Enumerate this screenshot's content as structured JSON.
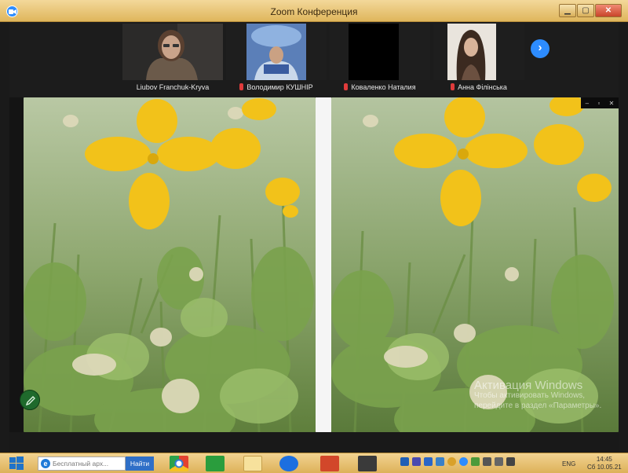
{
  "window": {
    "title": "Zoom Конференция",
    "controls": {
      "minimize": "▁",
      "maximize": "▢",
      "close": "✕"
    }
  },
  "participants": [
    {
      "name": "Liubov Franchuk-Kryva",
      "muted": false
    },
    {
      "name": "Володимир КУШНІР",
      "muted": true
    },
    {
      "name": "Коваленко Наталия",
      "muted": true
    },
    {
      "name": "Анна Філінська",
      "muted": true
    }
  ],
  "strip": {
    "next_icon": "chevron-right-icon",
    "next_glyph": "›"
  },
  "share": {
    "controls": [
      "–",
      "▫",
      "✕"
    ],
    "watermark": {
      "line1": "Активация Windows",
      "line2": "Чтобы активировать Windows,",
      "line3": "перейдите в раздел «Параметры»."
    },
    "annotate_icon": "pencil-icon"
  },
  "taskbar": {
    "search_placeholder": "Бесплатный арх...",
    "search_button": "Найти",
    "language": "ENG",
    "time": "14:45",
    "date": "Сб 10.05.21"
  },
  "colors": {
    "accent": "#2d8cff",
    "title_bar": "#e8c577",
    "mute_red": "#e03b3b",
    "flower_yellow": "#f2c21a",
    "leaf_green": "#5f8f3a"
  }
}
